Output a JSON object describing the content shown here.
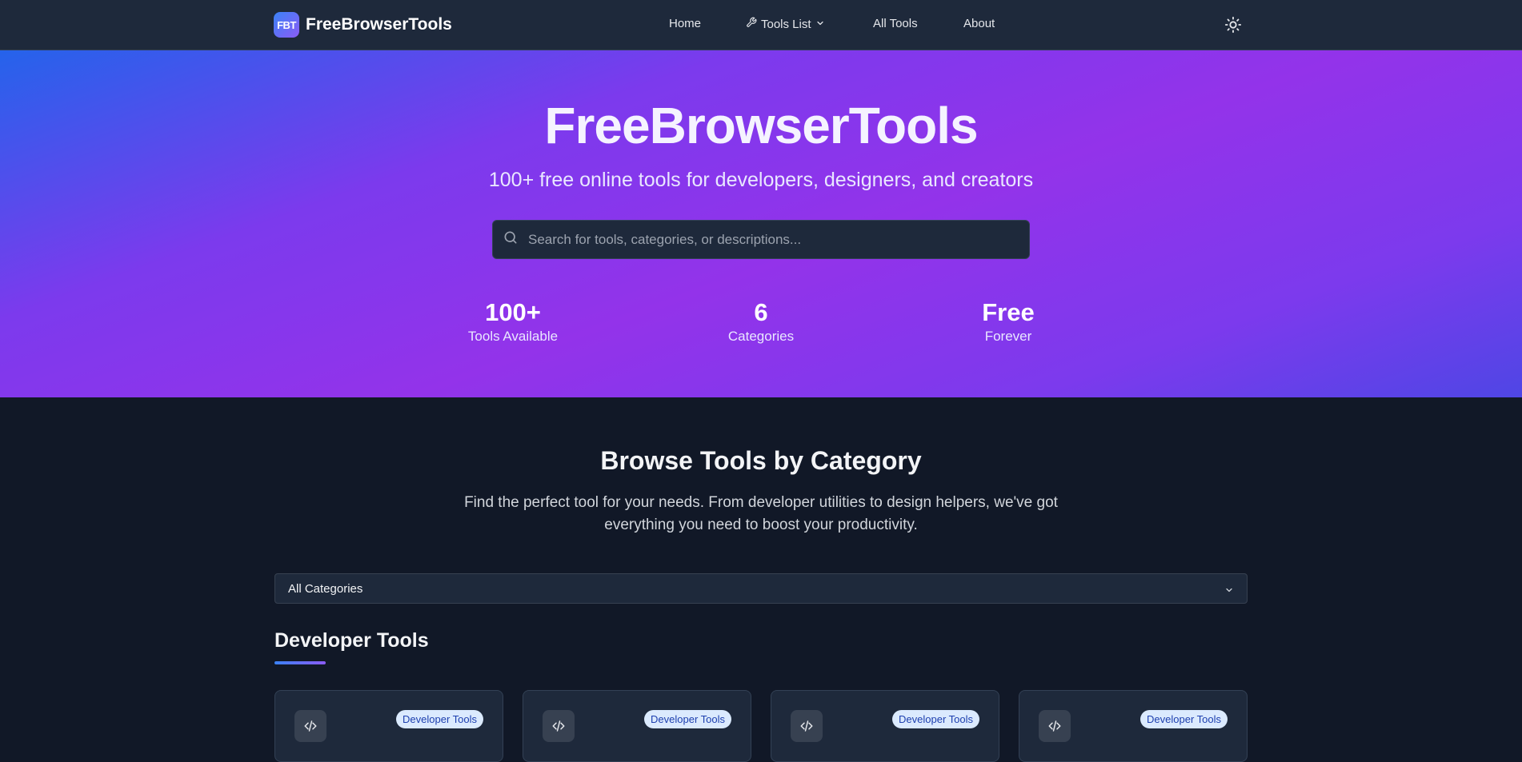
{
  "nav": {
    "brand_logo": "FBT",
    "brand_name": "FreeBrowserTools",
    "links": [
      {
        "label": "Home"
      },
      {
        "label": "Tools List",
        "icon": "wrench-icon",
        "dropdown": true
      },
      {
        "label": "All Tools"
      },
      {
        "label": "About"
      }
    ],
    "theme_icon": "sun-icon"
  },
  "hero": {
    "title": "FreeBrowserTools",
    "subtitle": "100+ free online tools for developers, designers, and creators",
    "search_placeholder": "Search for tools, categories, or descriptions...",
    "stats": [
      {
        "value": "100+",
        "label": "Tools Available"
      },
      {
        "value": "6",
        "label": "Categories"
      },
      {
        "value": "Free",
        "label": "Forever"
      }
    ]
  },
  "browse": {
    "title": "Browse Tools by Category",
    "description": "Find the perfect tool for your needs. From developer utilities to design helpers, we've got everything you need to boost your productivity.",
    "category_select": "All Categories",
    "group_title": "Developer Tools",
    "cards": [
      {
        "badge": "Developer Tools",
        "icon": "code-icon"
      },
      {
        "badge": "Developer Tools",
        "icon": "code-icon"
      },
      {
        "badge": "Developer Tools",
        "icon": "code-icon"
      },
      {
        "badge": "Developer Tools",
        "icon": "code-icon"
      }
    ]
  },
  "colors": {
    "nav_bg": "#1e293b",
    "page_bg": "#111827",
    "hero_gradient_start": "#2563eb",
    "hero_gradient_mid": "#9333ea",
    "hero_gradient_end": "#4f46e5",
    "badge_bg": "#dbeafe",
    "badge_text": "#1e40af"
  }
}
